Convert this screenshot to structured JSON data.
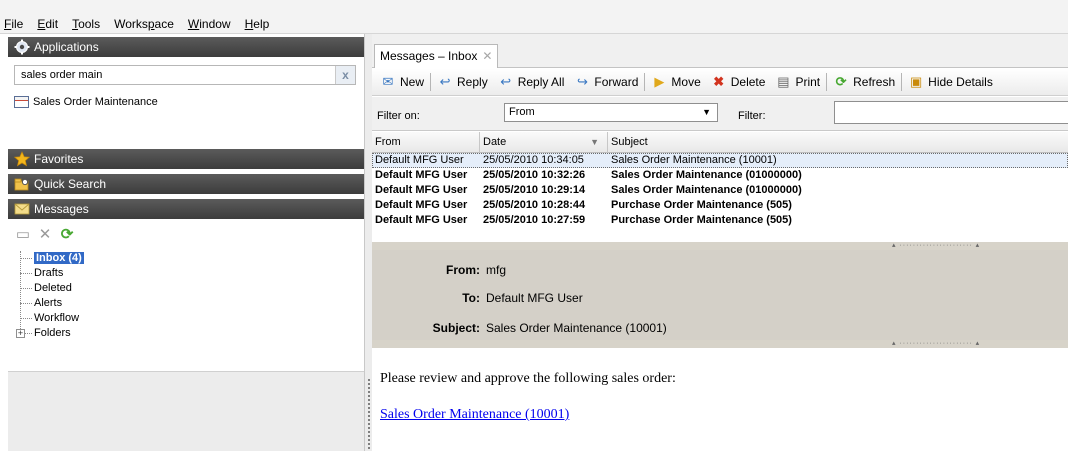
{
  "menubar": {
    "items": [
      {
        "pre": "",
        "accel": "F",
        "post": "ile"
      },
      {
        "pre": "",
        "accel": "E",
        "post": "dit"
      },
      {
        "pre": "",
        "accel": "T",
        "post": "ools"
      },
      {
        "pre": "Works",
        "accel": "p",
        "post": "ace"
      },
      {
        "pre": "",
        "accel": "W",
        "post": "indow"
      },
      {
        "pre": "",
        "accel": "H",
        "post": "elp"
      }
    ]
  },
  "left": {
    "applications": {
      "header": "Applications",
      "search_value": "sales order main",
      "clear_glyph": "x",
      "result": "Sales Order Maintenance"
    },
    "favorites_header": "Favorites",
    "quick_search_header": "Quick Search",
    "messages_header": "Messages",
    "tree": [
      "Inbox (4)",
      "Drafts",
      "Deleted",
      "Alerts",
      "Workflow",
      "Folders"
    ]
  },
  "right": {
    "tab": {
      "label": "Messages – Inbox",
      "close_glyph": "✕"
    },
    "toolbar": {
      "new": "New",
      "reply": "Reply",
      "reply_all": "Reply All",
      "forward": "Forward",
      "move": "Move",
      "delete": "Delete",
      "print": "Print",
      "refresh": "Refresh",
      "hide_details": "Hide Details"
    },
    "filter": {
      "filter_on_label": "Filter on:",
      "filter_on_value": "From",
      "filter_label": "Filter:",
      "filter_value": ""
    },
    "grid": {
      "columns": [
        "From",
        "Date",
        "Subject"
      ],
      "rows": [
        {
          "from": "Default MFG User",
          "date": "25/05/2010 10:34:05",
          "subject": "Sales Order Maintenance (10001)"
        },
        {
          "from": "Default MFG User",
          "date": "25/05/2010 10:32:26",
          "subject": "Sales Order Maintenance (01000000)"
        },
        {
          "from": "Default MFG User",
          "date": "25/05/2010 10:29:14",
          "subject": "Sales Order Maintenance (01000000)"
        },
        {
          "from": "Default MFG User",
          "date": "25/05/2010 10:28:44",
          "subject": "Purchase Order Maintenance (505)"
        },
        {
          "from": "Default MFG User",
          "date": "25/05/2010 10:27:59",
          "subject": "Purchase Order Maintenance (505)"
        }
      ]
    },
    "details": {
      "from_label": "From:",
      "from_value": "mfg",
      "to_label": "To:",
      "to_value": "Default MFG User",
      "subject_label": "Subject:",
      "subject_value": "Sales Order Maintenance (10001)"
    },
    "body": {
      "text": "Please review and approve the following sales order:",
      "link": "Sales Order Maintenance (10001)"
    }
  },
  "colors": {
    "section_header": "#4a4a4a",
    "selection": "#3169c6",
    "details_bg": "#d4d0c8",
    "link": "#0000ee"
  }
}
